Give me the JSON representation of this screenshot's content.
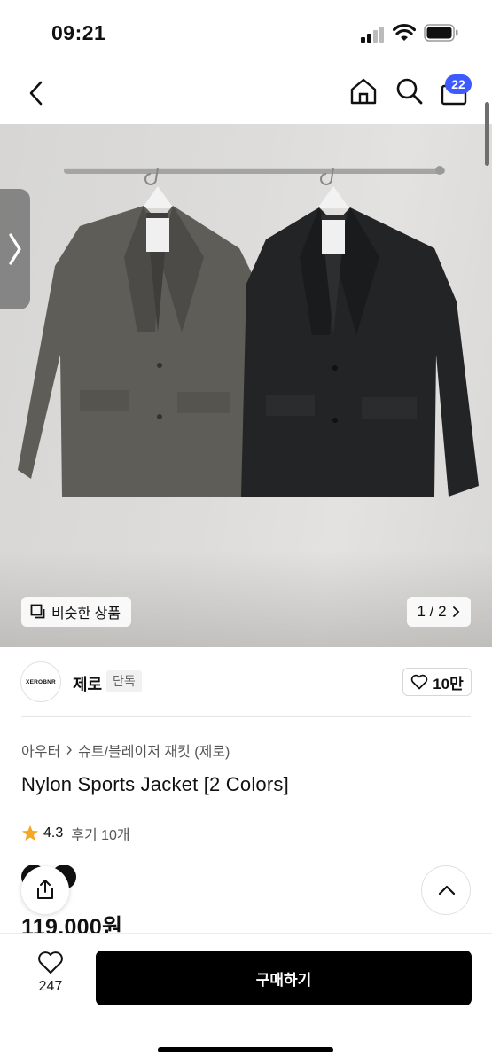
{
  "status_bar": {
    "time": "09:21"
  },
  "nav": {
    "cart_count": "22",
    "icons": [
      "back-icon",
      "home-icon",
      "search-icon",
      "cart-icon"
    ]
  },
  "gallery": {
    "similar_label": "비슷한 상품",
    "counter": "1 / 2"
  },
  "seller": {
    "logo_text": "XEROBNR",
    "name": "제로",
    "tag": "단독",
    "likes": "10만"
  },
  "product": {
    "breadcrumb": [
      "아우터",
      "슈트/블레이저 재킷 (제로)"
    ],
    "title": "Nylon Sports Jacket [2 Colors]",
    "rating": "4.3",
    "reviews": "후기 10개",
    "price": "119,000원"
  },
  "bottom": {
    "wish_count": "247",
    "buy_label": "구매하기"
  },
  "colors": {
    "accent": "#3d5afe",
    "star": "#f5a623",
    "buy_button": "#000000"
  }
}
